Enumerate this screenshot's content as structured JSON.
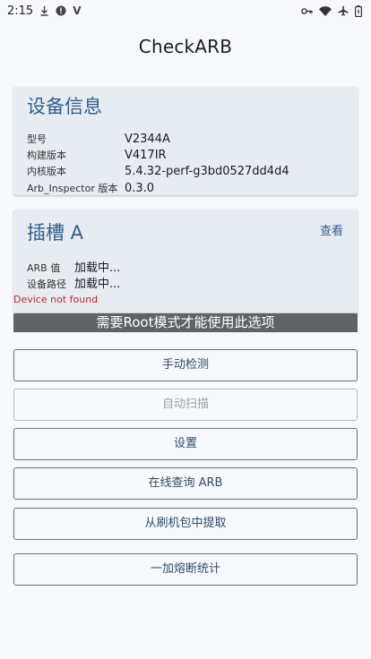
{
  "status_bar": {
    "time": "2:15",
    "letter": "V"
  },
  "app": {
    "title": "CheckARB"
  },
  "device_card": {
    "heading": "设备信息",
    "rows": [
      {
        "label": "型号",
        "value": "V2344A"
      },
      {
        "label": "构建版本",
        "value": "V417IR"
      },
      {
        "label": "内核版本",
        "value": "5.4.32-perf-g3bd0527dd4d4"
      },
      {
        "label": "Arb_Inspector 版本",
        "value": "0.3.0"
      }
    ]
  },
  "slot_card": {
    "heading": "插槽 A",
    "view_label": "查看",
    "rows": [
      {
        "label": "ARB 值",
        "value": "加载中..."
      },
      {
        "label": "设备路径",
        "value": "加载中..."
      }
    ]
  },
  "error": "Device not found",
  "root_banner": "需要Root模式才能使用此选项",
  "buttons": {
    "manual_check": "手动检测",
    "auto_scan": "自动扫描",
    "settings": "设置",
    "online_query": "在线查询 ARB",
    "extract_from_package": "从刷机包中提取",
    "oneplus_stats": "一加熔断统计"
  },
  "colors": {
    "accent": "#2f5f8a",
    "card_bg": "#e7ecf3",
    "error": "#c62828",
    "banner_bg": "#5f6266"
  }
}
